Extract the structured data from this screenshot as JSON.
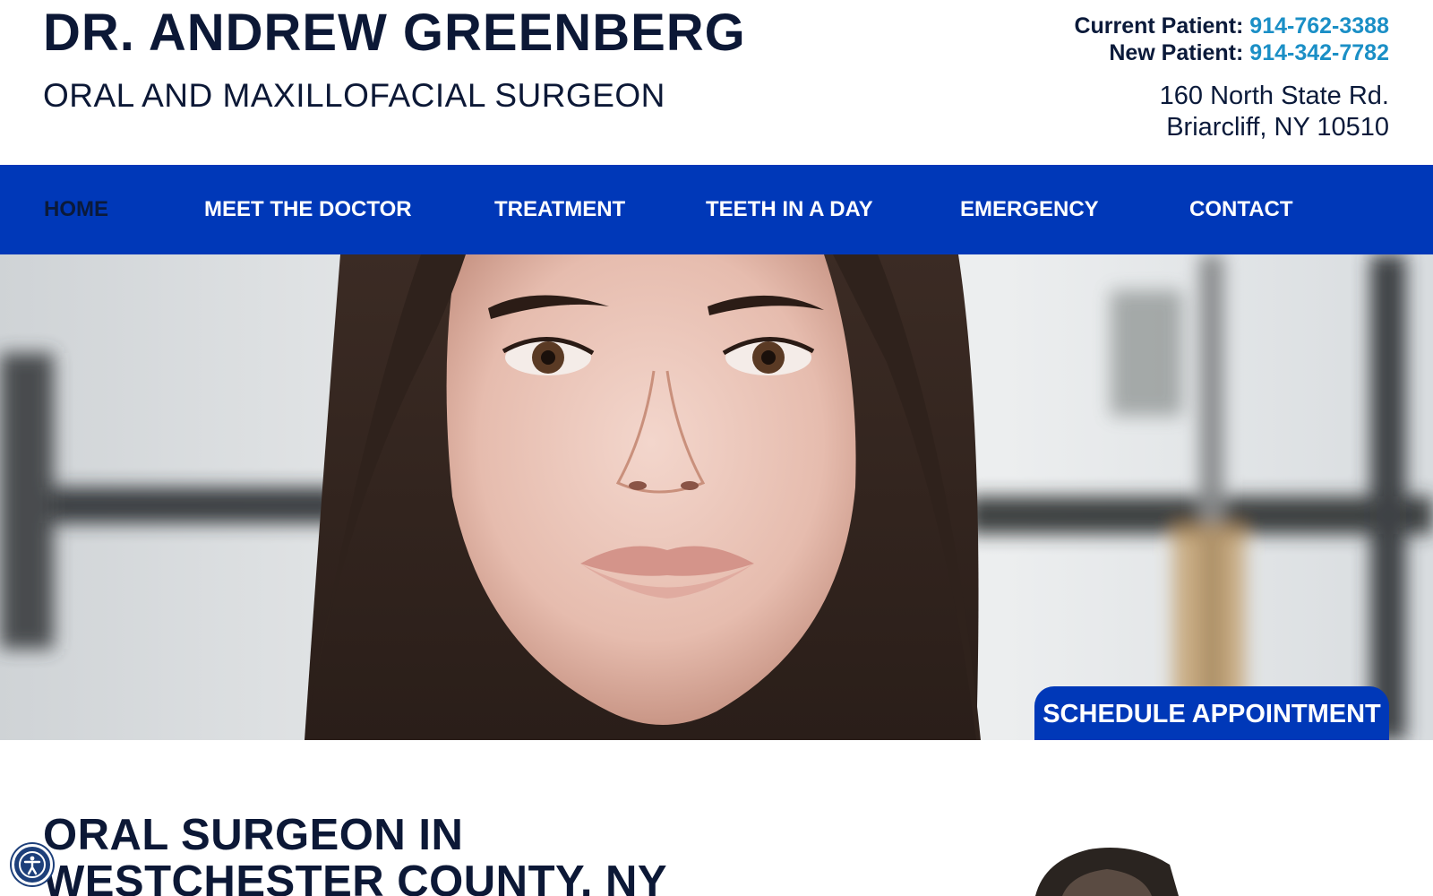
{
  "header": {
    "name": "DR. ANDREW GREENBERG",
    "title": "ORAL AND MAXILLOFACIAL SURGEON",
    "current_patient_label": "Current Patient:",
    "current_patient_phone": "914-762-3388",
    "new_patient_label": "New Patient:",
    "new_patient_phone": "914-342-7782",
    "address_line1": "160 North State Rd.",
    "address_line2": "Briarcliff, NY 10510"
  },
  "nav": {
    "items": [
      {
        "label": "HOME",
        "active": true
      },
      {
        "label": "MEET THE DOCTOR",
        "active": false
      },
      {
        "label": "TREATMENT",
        "active": false
      },
      {
        "label": "TEETH IN A DAY",
        "active": false
      },
      {
        "label": "EMERGENCY",
        "active": false
      },
      {
        "label": "CONTACT",
        "active": false
      }
    ]
  },
  "hero": {
    "cta_label": "SCHEDULE APPOINTMENT"
  },
  "content": {
    "heading": "ORAL SURGEON IN WESTCHESTER COUNTY, NY"
  },
  "icons": {
    "accessibility": "accessibility-icon"
  },
  "colors": {
    "nav_blue": "#0038b8",
    "phone_link": "#1b8fc6",
    "navy_text": "#0c1836"
  }
}
